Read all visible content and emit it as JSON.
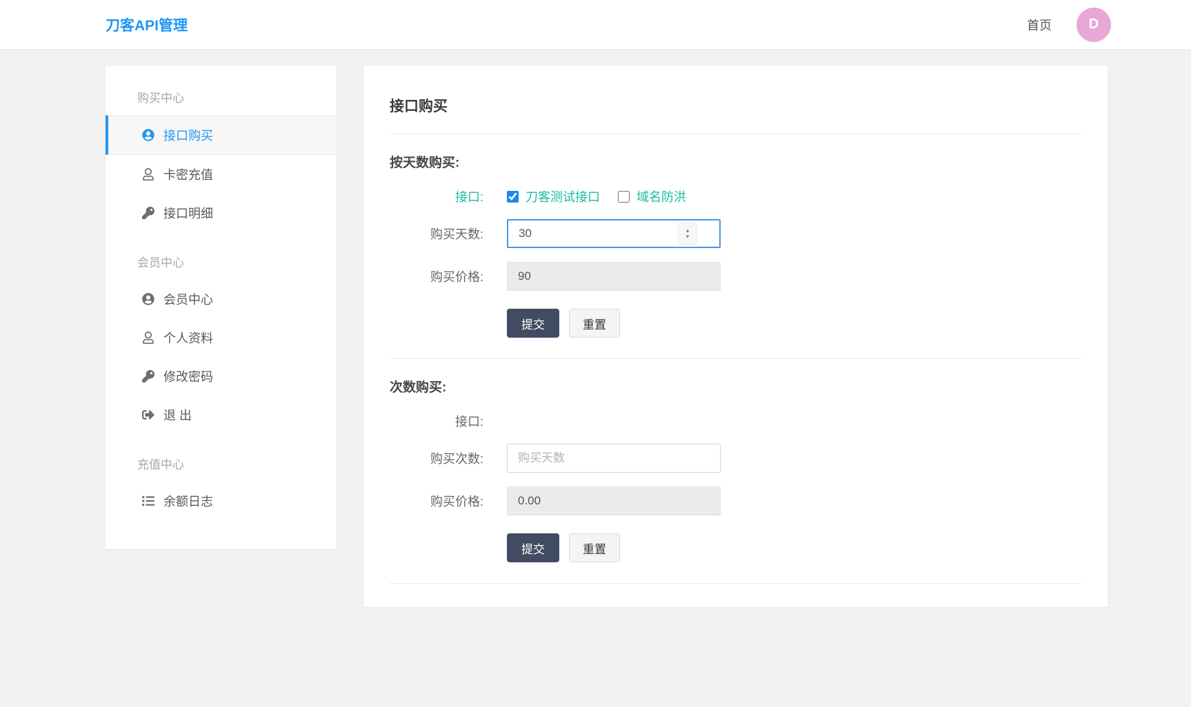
{
  "header": {
    "logo": "刀客API管理",
    "nav_home": "首页",
    "avatar_letter": "D"
  },
  "sidebar": {
    "sections": [
      {
        "title": "购买中心",
        "items": [
          {
            "label": "接口购买",
            "icon": "user-circle-icon",
            "active": true
          },
          {
            "label": "卡密充值",
            "icon": "user-icon",
            "active": false
          },
          {
            "label": "接口明细",
            "icon": "key-icon",
            "active": false
          }
        ]
      },
      {
        "title": "会员中心",
        "items": [
          {
            "label": "会员中心",
            "icon": "user-circle-icon",
            "active": false
          },
          {
            "label": "个人资料",
            "icon": "user-icon",
            "active": false
          },
          {
            "label": "修改密码",
            "icon": "key-icon",
            "active": false
          },
          {
            "label": "退 出",
            "icon": "sign-out-icon",
            "active": false
          }
        ]
      },
      {
        "title": "充值中心",
        "items": [
          {
            "label": "余额日志",
            "icon": "list-icon",
            "active": false
          }
        ]
      }
    ]
  },
  "main": {
    "title": "接口购买",
    "day_section": {
      "heading": "按天数购买:",
      "api_label": "接口:",
      "checkboxes": [
        {
          "label": "刀客测试接口",
          "checked": true
        },
        {
          "label": "域名防洪",
          "checked": false
        }
      ],
      "days_label": "购买天数:",
      "days_value": "30",
      "price_label": "购买价格:",
      "price_value": "90",
      "submit_label": "提交",
      "reset_label": "重置"
    },
    "count_section": {
      "heading": "次数购买:",
      "api_label": "接口:",
      "count_label": "购买次数:",
      "count_placeholder": "购买天数",
      "price_label": "购买价格:",
      "price_value": "0.00",
      "submit_label": "提交",
      "reset_label": "重置"
    }
  },
  "colors": {
    "brand-blue": "#2196f3",
    "accent-teal": "#1abc9c",
    "submit-dark": "#414b61",
    "avatar-pink": "#e8a7d5",
    "focus-border": "#4a97e7"
  }
}
